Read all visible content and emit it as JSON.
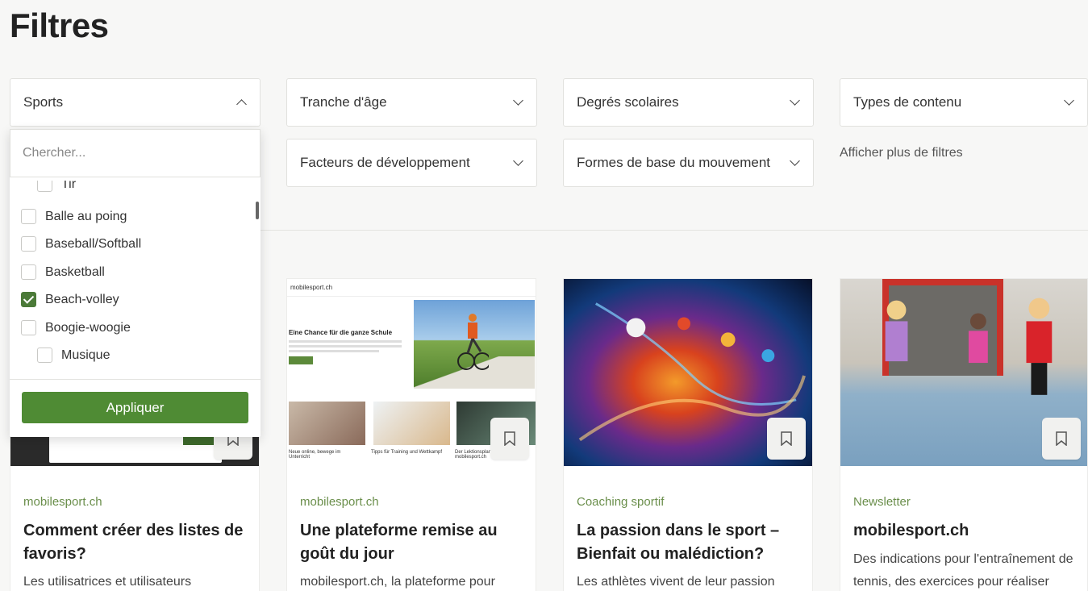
{
  "page": {
    "title": "Filtres"
  },
  "filters": {
    "sports": "Sports",
    "age_range": "Tranche d'âge",
    "school_levels": "Degrés scolaires",
    "content_types": "Types de contenu",
    "dev_factors": "Facteurs de développement",
    "movement_forms": "Formes de base du mouvement",
    "more_filters": "Afficher plus de filtres"
  },
  "sports_dropdown": {
    "search_placeholder": "Chercher...",
    "options": [
      {
        "label": "Tir",
        "checked": false
      },
      {
        "label": "Balle au poing",
        "checked": false
      },
      {
        "label": "Baseball/Softball",
        "checked": false
      },
      {
        "label": "Basketball",
        "checked": false
      },
      {
        "label": "Beach-volley",
        "checked": true
      },
      {
        "label": "Boogie-woogie",
        "checked": false
      },
      {
        "label": "Musique",
        "checked": false
      }
    ],
    "apply_label": "Appliquer"
  },
  "cards": [
    {
      "category": "mobilesport.ch",
      "title": "Comment créer des listes de favoris?",
      "text": "Les utilisatrices et utilisateurs"
    },
    {
      "category": "mobilesport.ch",
      "title": "Une plateforme remise au goût du jour",
      "text": "mobilesport.ch, la plateforme pour",
      "image": {
        "site": "mobilesport.ch",
        "headline": "Eine Chance für die ganze Schule",
        "captions": [
          "Neue online, bewege im Unterricht",
          "Tipps für Training und Wettkampf",
          "Der Lektionsplaner mobilesport.ch"
        ]
      }
    },
    {
      "category": "Coaching sportif",
      "title": "La passion dans le sport – Bienfait ou malédiction?",
      "text": "Les athlètes vivent de leur passion"
    },
    {
      "category": "Newsletter",
      "title": "mobilesport.ch",
      "text": "Des indications pour l'entraînement de tennis, des exercices pour réaliser"
    }
  ],
  "colors": {
    "accent": "#4f8b34",
    "category": "#6b8f4c",
    "background": "#f7f7f6"
  },
  "icons": {
    "chevron": "chevron-down-icon",
    "bookmark": "bookmark-icon",
    "check": "check-icon"
  }
}
